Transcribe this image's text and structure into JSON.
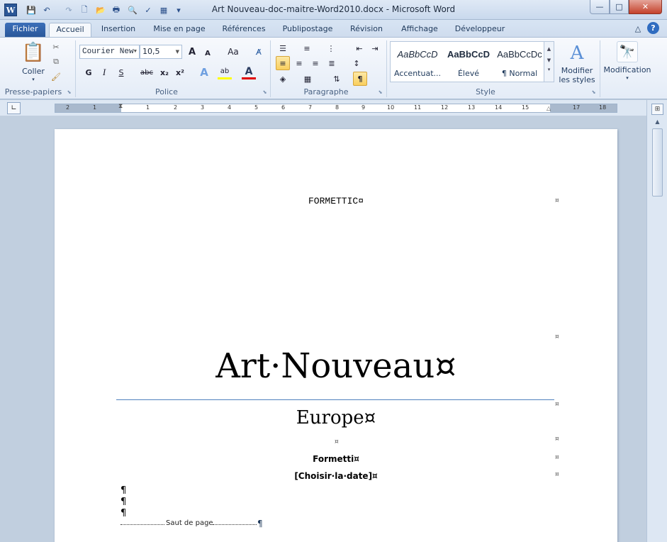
{
  "window": {
    "title": "Art Nouveau-doc-maitre-Word2010.docx  -  Microsoft Word",
    "app_icon": "W",
    "controls": {
      "minimize": "—",
      "maximize": "□",
      "close": "✕"
    }
  },
  "quick_access": {
    "icons": [
      "save-icon",
      "undo-icon",
      "redo-icon",
      "new-icon",
      "open-icon",
      "print-icon",
      "print-preview-icon",
      "spelling-icon",
      "draw-table-icon",
      "customize-icon"
    ],
    "glyphs": [
      "💾",
      "↶",
      "↷",
      "🗋",
      "📂",
      "🖶",
      "🔍",
      "✓",
      "▦",
      "▾"
    ]
  },
  "tabs": [
    {
      "label": "Fichier"
    },
    {
      "label": "Accueil"
    },
    {
      "label": "Insertion"
    },
    {
      "label": "Mise en page"
    },
    {
      "label": "Références"
    },
    {
      "label": "Publipostage"
    },
    {
      "label": "Révision"
    },
    {
      "label": "Affichage"
    },
    {
      "label": "Développeur"
    }
  ],
  "ribbon_right": {
    "minimize": "△",
    "help": "?"
  },
  "groups": {
    "clipboard": {
      "label": "Presse-papiers",
      "paste": "Coller"
    },
    "font": {
      "label": "Police",
      "family": "Courier New",
      "size": "10,5",
      "grow": "A",
      "shrink": "A",
      "case": "Aa",
      "bold": "G",
      "italic": "I",
      "underline": "S",
      "strike": "abc",
      "subscript": "x₂",
      "superscript": "x²",
      "effects": "A",
      "highlight": "ab",
      "color": "A"
    },
    "paragraph": {
      "label": "Paragraphe",
      "pilcrow": "¶"
    },
    "styles": {
      "label": "Style",
      "items": [
        {
          "sample": "AaBbCcD",
          "name": "Accentuat..."
        },
        {
          "sample": "AaBbCcD",
          "name": "Élevé"
        },
        {
          "sample": "AaBbCcDc",
          "name": "¶ Normal"
        }
      ],
      "modify": "Modifier les styles"
    },
    "editing": {
      "label": "Modification"
    }
  },
  "ruler": {
    "numbers": [
      "2",
      "1",
      "1",
      "1",
      "2",
      "3",
      "4",
      "5",
      "6",
      "7",
      "8",
      "9",
      "10",
      "11",
      "12",
      "13",
      "14",
      "15",
      "16",
      "17",
      "18"
    ]
  },
  "document": {
    "header_text": "FORMETTIC¤",
    "title": "Art·Nouveau¤",
    "subtitle": "Europe¤",
    "empty_cell": "¤",
    "author": "Formetti¤",
    "date": "[Choisir·la·date]¤",
    "pilcrow": "¶",
    "page_break": "Saut de page",
    "cell_marks": [
      "¤",
      "¤",
      "¤",
      "¤",
      "¤",
      "¤"
    ]
  },
  "colors": {
    "accent": "#2b579a",
    "title_rule": "#4f81bd",
    "selected_style": "#f9cf5e"
  }
}
